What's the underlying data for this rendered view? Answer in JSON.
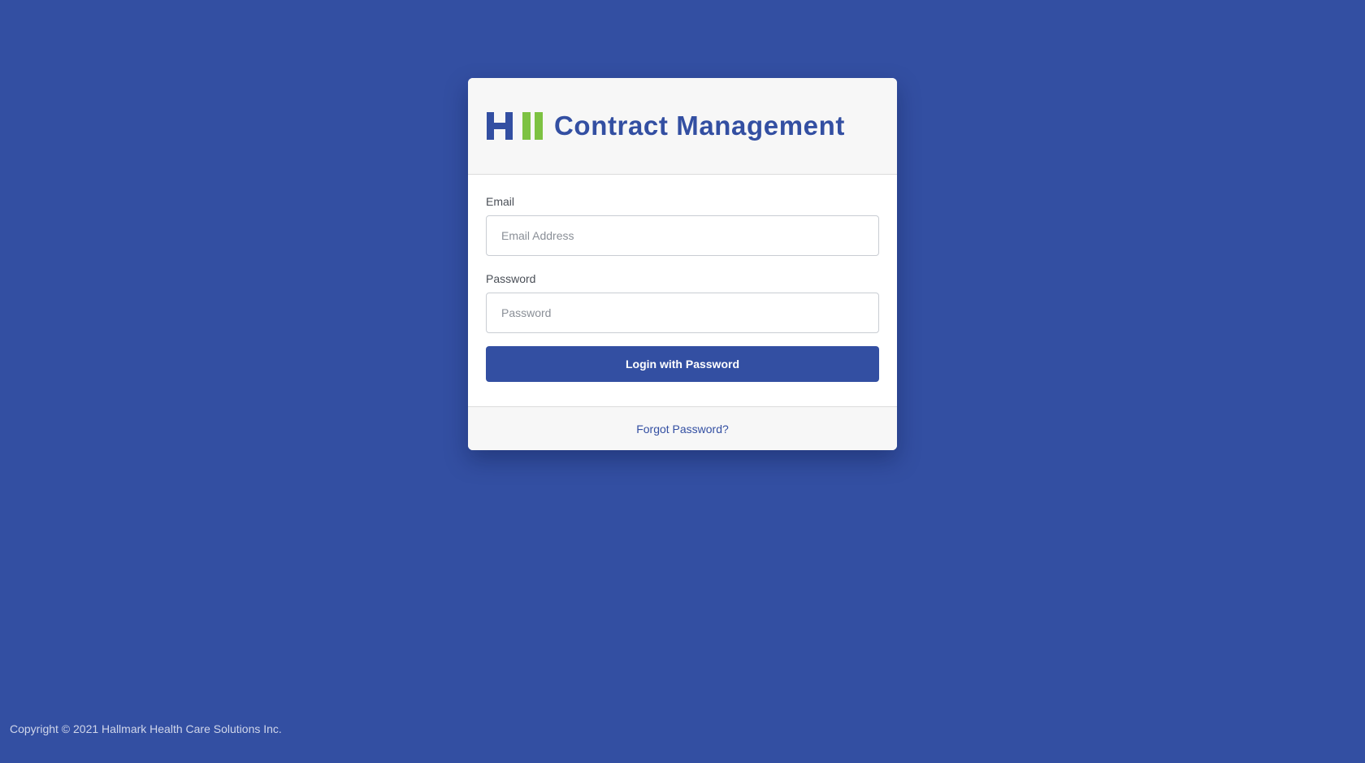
{
  "header": {
    "app_title": "Contract Management",
    "logo_icon": "hhs-logo-icon"
  },
  "form": {
    "email_label": "Email",
    "email_placeholder": "Email Address",
    "email_value": "",
    "password_label": "Password",
    "password_placeholder": "Password",
    "password_value": "",
    "login_button_label": "Login with Password"
  },
  "footer": {
    "forgot_password_label": "Forgot Password?"
  },
  "page_footer": {
    "copyright": "Copyright © 2021 Hallmark Health Care Solutions Inc."
  },
  "colors": {
    "background": "#334fa2",
    "brand_blue": "#334fa2",
    "brand_green": "#7dc242"
  }
}
